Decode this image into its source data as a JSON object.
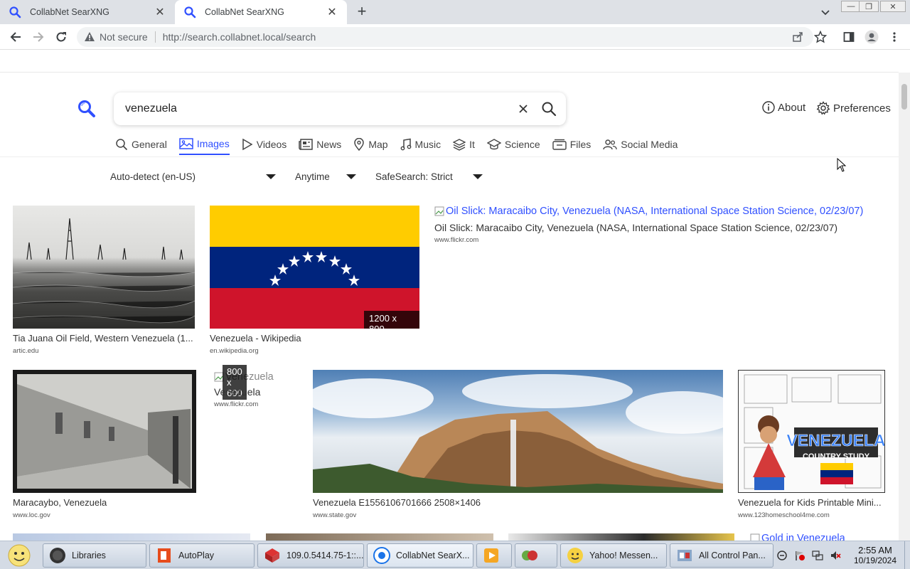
{
  "browser": {
    "tabs": [
      {
        "title": "CollabNet SearXNG",
        "active": false
      },
      {
        "title": "CollabNet SearXNG",
        "active": true
      }
    ],
    "security_label": "Not secure",
    "url": "http://search.collabnet.local/search"
  },
  "search": {
    "query": "venezuela",
    "about_label": "About",
    "preferences_label": "Preferences"
  },
  "categories": [
    {
      "label": "General",
      "icon": "search-icon",
      "active": false
    },
    {
      "label": "Images",
      "icon": "image-icon",
      "active": true
    },
    {
      "label": "Videos",
      "icon": "play-icon",
      "active": false
    },
    {
      "label": "News",
      "icon": "newspaper-icon",
      "active": false
    },
    {
      "label": "Map",
      "icon": "map-pin-icon",
      "active": false
    },
    {
      "label": "Music",
      "icon": "music-note-icon",
      "active": false
    },
    {
      "label": "It",
      "icon": "layers-icon",
      "active": false
    },
    {
      "label": "Science",
      "icon": "graduation-cap-icon",
      "active": false
    },
    {
      "label": "Files",
      "icon": "files-icon",
      "active": false
    },
    {
      "label": "Social Media",
      "icon": "people-icon",
      "active": false
    }
  ],
  "filters": {
    "language": "Auto-detect (en-US)",
    "time": "Anytime",
    "safesearch": "SafeSearch: Strict"
  },
  "results": [
    {
      "title": "Tia Juana Oil Field, Western Venezuela (1...",
      "source": "artic.edu"
    },
    {
      "title": "Venezuela - Wikipedia",
      "source": "en.wikipedia.org",
      "size": "1200 x 800"
    },
    {
      "alt": "Oil Slick: Maracaibo City, Venezuela (NASA, International Space Station Science, 02/23/07)",
      "title": "Oil Slick: Maracaibo City, Venezuela (NASA, International Space Station Science, 02/23/07)",
      "source": "www.flickr.com"
    },
    {
      "title": "Maracaybo, Venezuela",
      "source": "www.loc.gov"
    },
    {
      "alt": "Venezuela",
      "title": "Venezuela",
      "source": "www.flickr.com",
      "size": "800 x 600"
    },
    {
      "title": "Venezuela E1556106701666 2508×1406",
      "source": "www.state.gov"
    },
    {
      "title": "Venezuela for Kids Printable Mini...",
      "source": "www.123homeschool4me.com",
      "poster_title": "VENEZUELA",
      "poster_subtitle": "COUNTRY STUDY"
    },
    {
      "alt": "Gold in Venezuela"
    }
  ],
  "taskbar": {
    "items": [
      {
        "label": "Libraries"
      },
      {
        "label": "AutoPlay"
      },
      {
        "label": "109.0.5414.75-1::..."
      },
      {
        "label": "CollabNet SearX..."
      },
      {
        "label": ""
      },
      {
        "label": ""
      },
      {
        "label": "Yahoo! Messen..."
      },
      {
        "label": "All Control Pan..."
      }
    ],
    "time": "2:55 AM",
    "date": "10/19/2024"
  },
  "colors": {
    "accent": "#3050ff",
    "flag_yellow": "#ffcc00",
    "flag_blue": "#00247d",
    "flag_red": "#cf142b"
  }
}
